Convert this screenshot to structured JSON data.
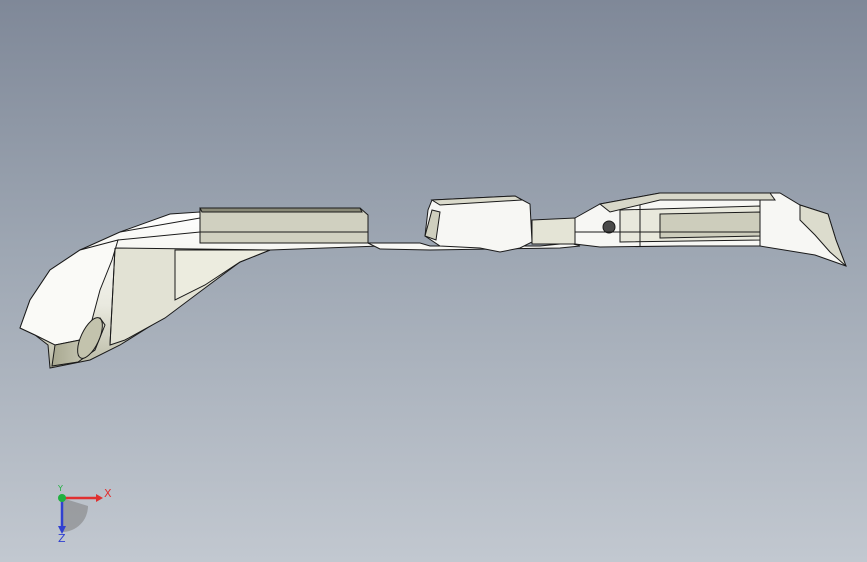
{
  "viewport": {
    "background_top": "#7f8898",
    "background_bottom": "#c2c8d0"
  },
  "model": {
    "part_fill": "#f7f7f4",
    "shade_fill": "#c9c9b8",
    "edge_color": "#1a1a1a"
  },
  "triad": {
    "x_label": "X",
    "y_label": "Y",
    "z_label": "Z",
    "x_color": "#e03030",
    "y_color": "#20b040",
    "z_color": "#3040d0"
  }
}
